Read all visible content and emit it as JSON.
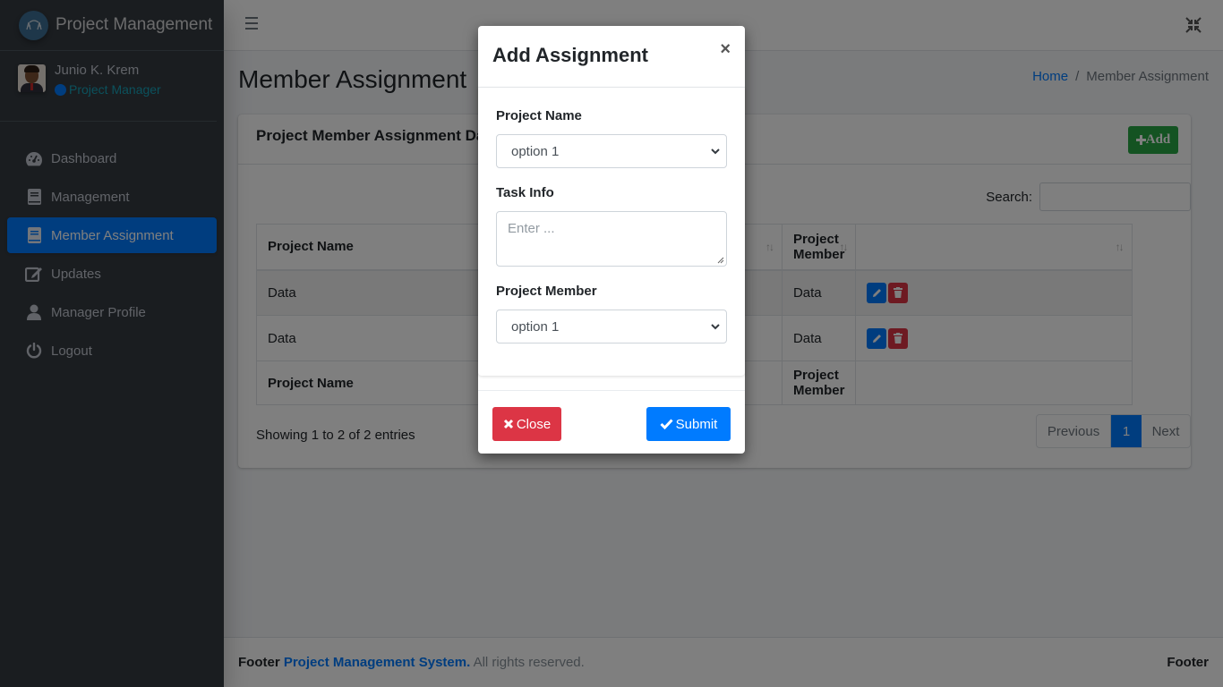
{
  "app": {
    "brand": "Project Management",
    "user": {
      "name": "Junio K. Krem",
      "role": "Project Manager"
    }
  },
  "sidebar": {
    "items": [
      {
        "label": "Dashboard",
        "icon": "tachometer-icon",
        "active": false
      },
      {
        "label": "Management",
        "icon": "book-icon",
        "active": false
      },
      {
        "label": "Member Assignment",
        "icon": "book-icon",
        "active": true
      },
      {
        "label": "Updates",
        "icon": "edit-icon",
        "active": false
      },
      {
        "label": "Manager Profile",
        "icon": "user-icon",
        "active": false
      },
      {
        "label": "Logout",
        "icon": "power-icon",
        "active": false
      }
    ]
  },
  "page": {
    "title": "Member Assignment",
    "breadcrumb": {
      "home": "Home",
      "separator": "/",
      "current": "Member Assignment"
    }
  },
  "card": {
    "title": "Project Member Assignment Data",
    "add_label": "Add",
    "search_label": "Search:",
    "search_value": "",
    "table": {
      "columns": [
        "Project Name",
        "",
        "Project Member",
        ""
      ],
      "rows": [
        [
          "Data",
          "",
          "Data"
        ],
        [
          "Data",
          "",
          "Data"
        ]
      ],
      "footer": [
        "Project Name",
        "",
        "Project Member",
        ""
      ]
    },
    "info": "Showing 1 to 2 of 2 entries",
    "pagination": {
      "previous": "Previous",
      "current": "1",
      "next": "Next"
    }
  },
  "footer": {
    "prefix": "Footer",
    "link": "Project Management System.",
    "suffix": "All rights reserved.",
    "right": "Footer"
  },
  "modal": {
    "title": "Add Assignment",
    "close_glyph": "×",
    "fields": {
      "project_name": {
        "label": "Project Name",
        "value": "option 1"
      },
      "task_info": {
        "label": "Task Info",
        "placeholder": "Enter ..."
      },
      "project_member": {
        "label": "Project Member",
        "value": "option 1"
      }
    },
    "close_label": "Close",
    "submit_label": "Submit"
  },
  "colors": {
    "primary": "#007bff",
    "success": "#28a745",
    "danger": "#dc3545",
    "sidebar": "#343a40"
  }
}
